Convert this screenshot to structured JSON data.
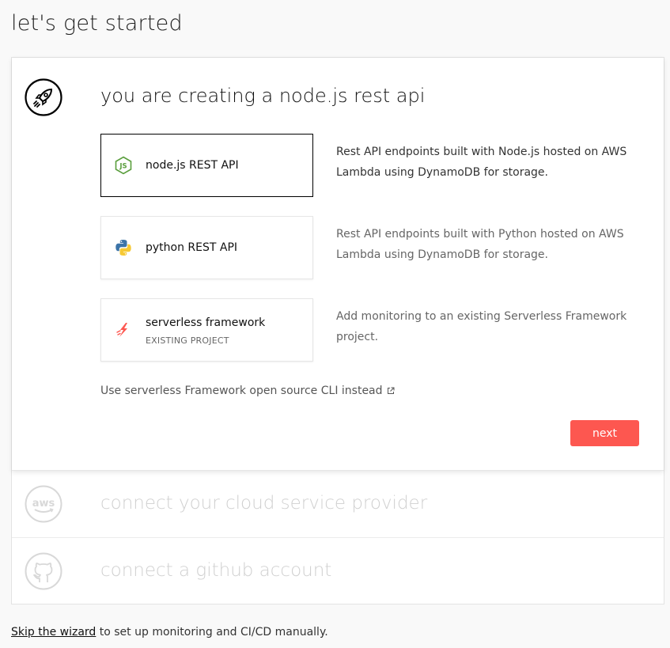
{
  "page": {
    "title": "let's get started"
  },
  "active_step": {
    "title": "you are creating a node.js rest api",
    "icon": "rocket-icon",
    "options": [
      {
        "label": "node.js REST API",
        "icon": "nodejs-icon",
        "selected": true,
        "description": "Rest API endpoints built with Node.js hosted on AWS Lambda using DynamoDB for storage."
      },
      {
        "label": "python REST API",
        "icon": "python-icon",
        "selected": false,
        "description": "Rest API endpoints built with Python hosted on AWS Lambda using DynamoDB for storage."
      },
      {
        "label": "serverless framework",
        "sublabel": "EXISTING PROJECT",
        "icon": "serverless-icon",
        "selected": false,
        "description": "Add monitoring to an existing Serverless Framework project."
      }
    ],
    "cli_link": "Use serverless Framework open source CLI instead",
    "next_label": "next",
    "accent": "#fd5750"
  },
  "steps": [
    {
      "title": "connect your cloud service provider",
      "icon": "aws-icon"
    },
    {
      "title": "connect a github account",
      "icon": "github-icon"
    }
  ],
  "footer": {
    "link": "Skip the wizard",
    "text": " to set up monitoring and CI/CD manually."
  }
}
